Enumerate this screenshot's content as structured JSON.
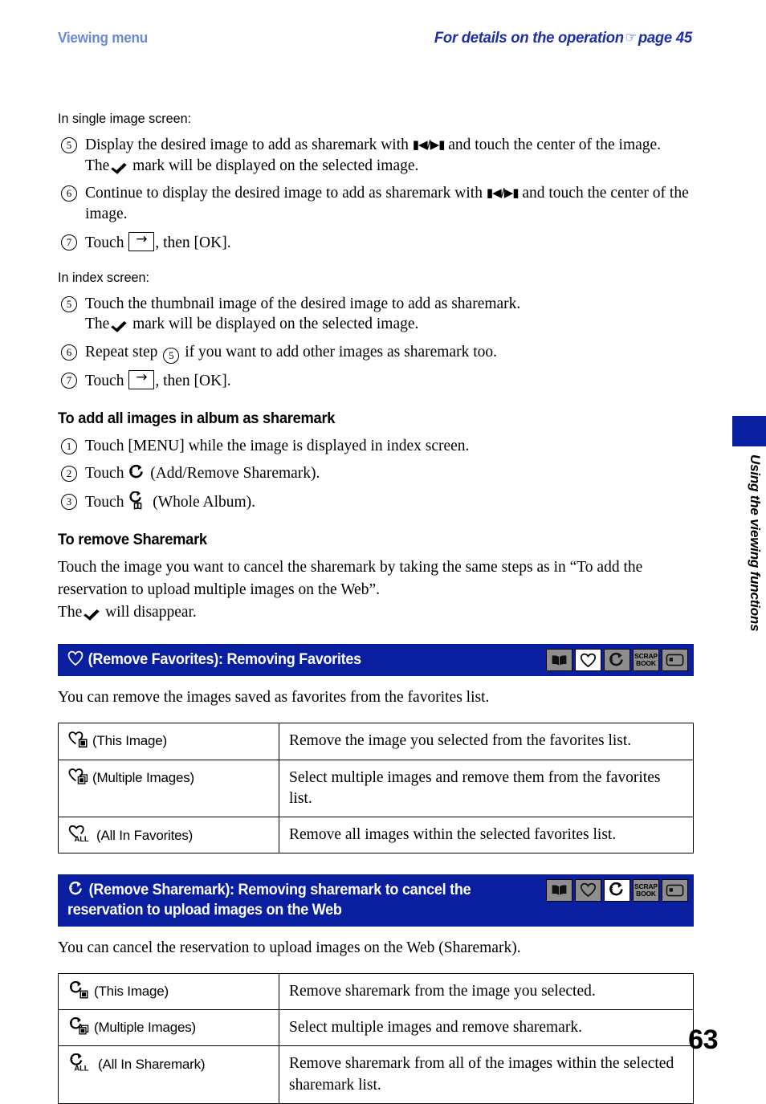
{
  "header": {
    "left_title": "Viewing menu",
    "right_title_before": "For details on the operation",
    "hand_icon": "pointing-hand-icon",
    "right_title_after": "page 45"
  },
  "body": {
    "single_image_label": "In single image screen:",
    "single_image_steps": [
      {
        "num": "5",
        "text_a": "Display the desired image to add as sharemark with",
        "glyph": "prev-next-buttons-icon",
        "text_b": "and touch the center of the image.",
        "text_c": "The",
        "glyph2": "check-mark-icon",
        "text_d": "mark will be displayed on the selected image."
      },
      {
        "num": "6",
        "text_a": "Continue to display the desired image to add as sharemark with",
        "glyph": "prev-next-buttons-icon",
        "text_b": "and touch the center of the image."
      },
      {
        "num": "7",
        "text_a": "Touch",
        "glyph": "arrow-right-button-icon",
        "text_b": ", then [OK]."
      }
    ],
    "index_label": "In index screen:",
    "index_steps": [
      {
        "num": "5",
        "text_a": "Touch the thumbnail image of the desired image to add as sharemark.",
        "text_c": "The",
        "glyph2": "check-mark-icon",
        "text_d": "mark will be displayed on the selected image."
      },
      {
        "num": "6",
        "text_a": "Repeat step",
        "ref_num": "5",
        "text_b": "if you want to add other images as sharemark too."
      },
      {
        "num": "7",
        "text_a": "Touch",
        "glyph": "arrow-right-button-icon",
        "text_b": ", then [OK]."
      }
    ],
    "add_all_heading": "To add all images in album as sharemark",
    "add_all_steps": [
      {
        "num": "1",
        "text_a": "Touch [MENU] while the image is displayed in index screen."
      },
      {
        "num": "2",
        "text_a": "Touch",
        "glyph": "sharemark-icon",
        "text_b": "(Add/Remove Sharemark)."
      },
      {
        "num": "3",
        "text_a": "Touch",
        "glyph": "whole-album-icon",
        "text_b": "(Whole Album)."
      }
    ],
    "remove_heading": "To remove Sharemark",
    "remove_para_line1": "Touch the image you want to cancel the sharemark by taking the same steps as in “To add the",
    "remove_para_line2": "reservation to upload multiple images on the Web”.",
    "remove_para_line3_a": "The",
    "remove_para_line3_glyph": "check-mark-icon",
    "remove_para_line3_b": "will disappear."
  },
  "section_favorites": {
    "banner_icon": "heart-outline-icon",
    "banner_title": "(Remove Favorites): Removing Favorites",
    "intro": "You can remove the images saved as favorites from the favorites list.",
    "icon_strip": [
      {
        "name": "book-icon",
        "active": false
      },
      {
        "name": "heart-icon",
        "active": true
      },
      {
        "name": "sharemark-icon",
        "active": false
      },
      {
        "name": "scrap-book-icon",
        "active": false,
        "line1": "SCRAP",
        "line2": "BOOK"
      },
      {
        "name": "screen-icon",
        "active": false
      }
    ],
    "rows": [
      {
        "icon": "heart-this-image-icon",
        "label": "(This Image)",
        "desc": "Remove the image you selected from the favorites list."
      },
      {
        "icon": "heart-multiple-images-icon",
        "label": "(Multiple Images)",
        "desc": "Select multiple images and remove them from the favorites list."
      },
      {
        "icon": "heart-all-icon",
        "label": "(All In Favorites)",
        "desc": "Remove all images within the selected favorites list."
      }
    ]
  },
  "section_sharemark": {
    "banner_icon": "sharemark-icon",
    "banner_title_line1": "(Remove Sharemark): Removing sharemark to cancel the",
    "banner_title_line2": "reservation to upload images on the Web",
    "intro": "You can cancel the reservation to upload images on the Web (Sharemark).",
    "icon_strip": [
      {
        "name": "book-icon",
        "active": false
      },
      {
        "name": "heart-icon",
        "active": false
      },
      {
        "name": "sharemark-icon",
        "active": true
      },
      {
        "name": "scrap-book-icon",
        "active": false,
        "line1": "SCRAP",
        "line2": "BOOK"
      },
      {
        "name": "screen-icon",
        "active": false
      }
    ],
    "rows": [
      {
        "icon": "sharemark-this-image-icon",
        "label": "(This Image)",
        "desc": "Remove sharemark from the image you selected."
      },
      {
        "icon": "sharemark-multiple-images-icon",
        "label": "(Multiple Images)",
        "desc": "Select multiple images and remove sharemark."
      },
      {
        "icon": "sharemark-all-icon",
        "label": "(All In Sharemark)",
        "desc": "Remove sharemark from all of the images within the selected sharemark list."
      }
    ]
  },
  "side_tab": {
    "text": "Using the viewing functions"
  },
  "footer": {
    "page_number": "63"
  },
  "colors": {
    "banner_blue": "#0a1fa0",
    "header_left_blue": "#6a8ad4",
    "header_right_blue": "#1d2ea8",
    "icon_cell_gray": "#8e8e8e"
  }
}
